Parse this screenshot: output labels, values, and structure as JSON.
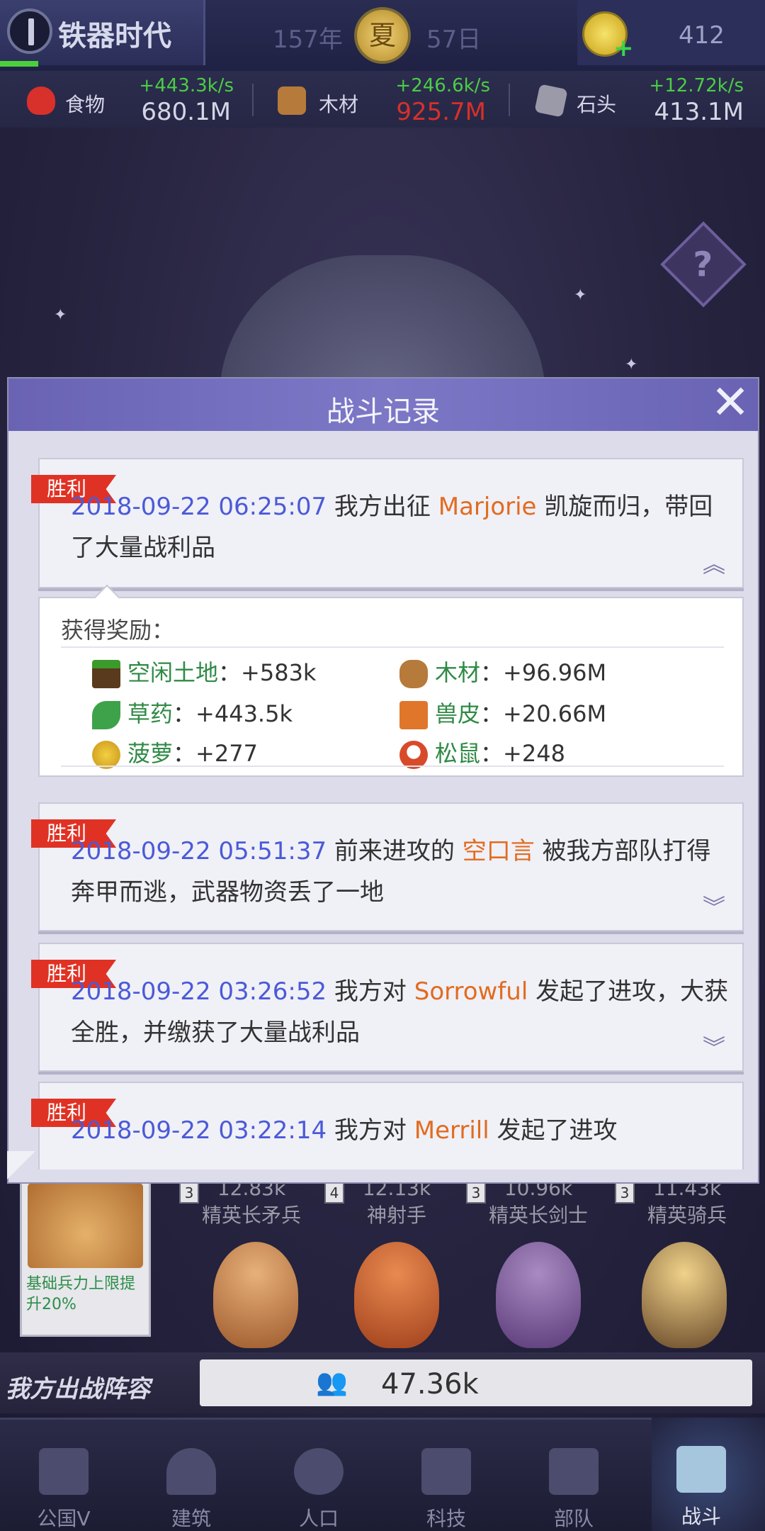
{
  "top": {
    "era_name": "铁器时代",
    "year": "157年",
    "season": "夏",
    "day": "57日",
    "gem_count": "412",
    "era_progress": 0.05
  },
  "resources": [
    {
      "label": "食物",
      "rate": "+443.3k/s",
      "total": "680.1M",
      "total_color": "normal",
      "icon": "meat-icon",
      "color": "#d8302a"
    },
    {
      "label": "木材",
      "rate": "+246.6k/s",
      "total": "925.7M",
      "total_color": "red",
      "icon": "wood-icon",
      "color": "#b67a3a"
    },
    {
      "label": "石头",
      "rate": "+12.72k/s",
      "total": "413.1M",
      "total_color": "normal",
      "icon": "stone-icon",
      "color": "#9a9aa8"
    }
  ],
  "dialog": {
    "title": "战斗记录",
    "close": "✕",
    "entries": [
      {
        "badge": "胜利",
        "date": "2018-09-22 06:25:07",
        "pre": " 我方出征 ",
        "name": "Marjorie",
        "post": " 凯旋而归，带回了大量战利品",
        "expanded": true
      },
      {
        "badge": "胜利",
        "date": "2018-09-22 05:51:37",
        "pre": " 前来进攻的 ",
        "name": "空口言",
        "post": " 被我方部队打得奔甲而逃，武器物资丢了一地",
        "expanded": false
      },
      {
        "badge": "胜利",
        "date": "2018-09-22 03:26:52",
        "pre": " 我方对 ",
        "name": "Sorrowful",
        "post": " 发起了进攻，大获全胜，并缴获了大量战利品",
        "expanded": false
      },
      {
        "badge": "胜利",
        "date": "2018-09-22 03:22:14",
        "pre": " 我方对 ",
        "name": "Merrill",
        "post": " 发起了进攻",
        "expanded": false
      }
    ],
    "reward": {
      "title": "获得奖励：",
      "items": [
        {
          "name": "空闲土地",
          "sep": "：",
          "value": "+583k",
          "icon": "land-icon",
          "color": "#4b7a2a"
        },
        {
          "name": "木材",
          "sep": "：",
          "value": "+96.96M",
          "icon": "wood-icon",
          "color": "#b67a3a"
        },
        {
          "name": "草药",
          "sep": "：",
          "value": "+443.5k",
          "icon": "herb-icon",
          "color": "#3ea24a"
        },
        {
          "name": "兽皮",
          "sep": "：",
          "value": "+20.66M",
          "icon": "hide-icon",
          "color": "#e0762a"
        },
        {
          "name": "菠萝",
          "sep": "：",
          "value": "+277",
          "icon": "pineapple-icon",
          "color": "#e2b820"
        },
        {
          "name": "松鼠",
          "sep": "：",
          "value": "+248",
          "icon": "squirrel-icon",
          "color": "#d84a2a"
        }
      ]
    }
  },
  "army": {
    "bonus_text": "基础兵力上限提升20%",
    "units": [
      {
        "count": "12.83k",
        "name": "精英长矛兵",
        "level": "3"
      },
      {
        "count": "12.13k",
        "name": "神射手",
        "level": "4"
      },
      {
        "count": "10.96k",
        "name": "精英长剑士",
        "level": "3"
      },
      {
        "count": "11.43k",
        "name": "精英骑兵",
        "level": "3"
      }
    ],
    "lineup_title": "我方出战阵容",
    "lineup_value": "47.36k"
  },
  "nav": [
    {
      "label": "公国V",
      "icon": "castle-icon",
      "active": false
    },
    {
      "label": "建筑",
      "icon": "house-icon",
      "active": false
    },
    {
      "label": "人口",
      "icon": "person-icon",
      "active": false
    },
    {
      "label": "科技",
      "icon": "book-icon",
      "active": false
    },
    {
      "label": "部队",
      "icon": "banner-icon",
      "active": false
    },
    {
      "label": "战斗",
      "icon": "swords-icon",
      "active": true
    }
  ],
  "colors": {
    "date": "#4b5ad8",
    "name": "#e26b1e",
    "badge": "#e03224",
    "reward_name": "#2f8a45",
    "dialog_header": "#6a63b4"
  }
}
